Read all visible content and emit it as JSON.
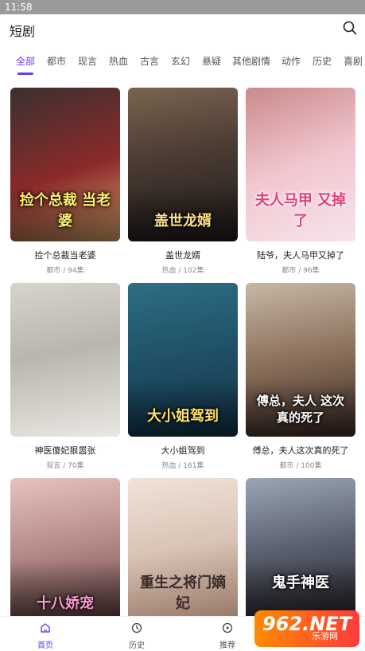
{
  "status": {
    "time": "11:58"
  },
  "header": {
    "title": "短剧"
  },
  "icons": {
    "search": "search-icon"
  },
  "tabs": [
    "全部",
    "都市",
    "现言",
    "热血",
    "古言",
    "玄幻",
    "悬疑",
    "其他剧情",
    "动作",
    "历史",
    "喜剧"
  ],
  "colors": {
    "accent": "#6a3df0"
  },
  "shows": [
    {
      "name": "捡个总裁当老婆",
      "meta": "都市 / 94集",
      "caption": "捡个总裁 当老婆"
    },
    {
      "name": "盖世龙婿",
      "meta": "热血 / 102集",
      "caption": "盖世龙婿"
    },
    {
      "name": "陆爷，夫人马甲又掉了",
      "meta": "都市 / 96集",
      "caption": "夫人马甲 又掉了"
    },
    {
      "name": "神医傻妃狠嚣张",
      "meta": "现言 / 70集",
      "caption": ""
    },
    {
      "name": "大小姐驾到",
      "meta": "热血 / 161集",
      "caption": "大小姐驾到"
    },
    {
      "name": "傅总，夫人这次真的死了",
      "meta": "都市 / 100集",
      "caption": "傅总，夫人 这次真的死了"
    },
    {
      "name": "",
      "meta": "",
      "caption": "十八娇宠"
    },
    {
      "name": "",
      "meta": "",
      "caption": "重生之将门嫡妃"
    },
    {
      "name": "",
      "meta": "",
      "caption": "鬼手神医"
    }
  ],
  "nav": {
    "home": "首页",
    "history": "历史",
    "recommend": "推荐"
  },
  "watermark": {
    "big": "962.NET",
    "sub": "乐游网"
  }
}
